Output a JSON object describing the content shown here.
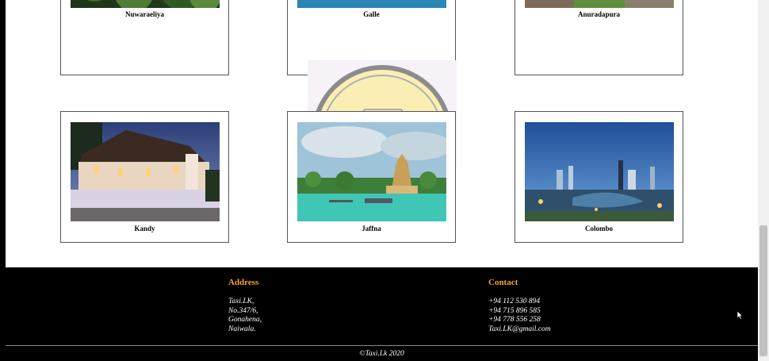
{
  "destinations_row1": [
    {
      "name": "Nuwaraeliya"
    },
    {
      "name": "Galle"
    },
    {
      "name": "Anuradapura"
    }
  ],
  "destinations_row2": [
    {
      "name": "Kandy"
    },
    {
      "name": "Jaffna"
    },
    {
      "name": "Colombo"
    }
  ],
  "footer": {
    "address_heading": "Address",
    "address_lines": [
      "Taxi.LK,",
      "No.347/6,",
      "Gonahena,",
      "Naiwala."
    ],
    "contact_heading": "Contact",
    "contact_lines": [
      "+94 112 530 894",
      "+94 715 896 585",
      "+94 778 556 258",
      "Taxi.LK@gmail.com"
    ],
    "copyright": "©Taxi.Lk 2020"
  },
  "colors": {
    "footer_background": "#000000",
    "footer_heading": "#f5a623",
    "page_background": "#ffffff"
  }
}
